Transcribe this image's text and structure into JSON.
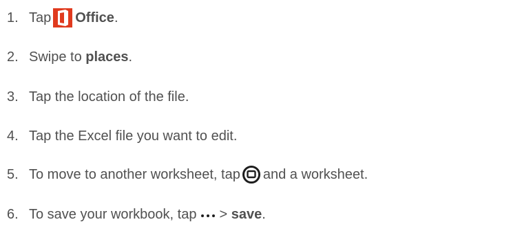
{
  "steps": [
    {
      "num": "1.",
      "pre": "Tap",
      "bold": "Office",
      "post": ".",
      "icon": "office-icon"
    },
    {
      "num": "2.",
      "pre": "Swipe to ",
      "bold": "places",
      "post": "."
    },
    {
      "num": "3.",
      "pre": "Tap the location of the file."
    },
    {
      "num": "4.",
      "pre": "Tap the Excel file you want to edit."
    },
    {
      "num": "5.",
      "pre": "To move to another worksheet, tap",
      "post": "and a worksheet.",
      "icon": "switch-worksheet-icon"
    },
    {
      "num": "6.",
      "pre": "To save your workbook, tap",
      "mid": "> ",
      "bold": "save",
      "post": ".",
      "icon": "more-icon"
    }
  ],
  "colors": {
    "text": "#505050",
    "office_red": "#e03a1e",
    "icon_dark": "#1e1e1e"
  }
}
